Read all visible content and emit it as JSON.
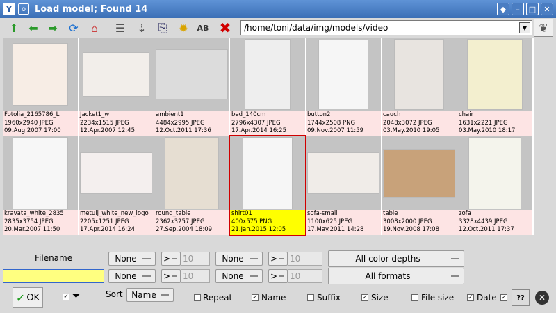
{
  "window": {
    "title": "Load model; Found 14"
  },
  "path": {
    "value": "/home/toni/data/img/models/video"
  },
  "items": [
    {
      "name": "Fotolia_2165786_L",
      "dims": "1960x2940 JPEG",
      "date": "09.Aug.2007 17:00"
    },
    {
      "name": "Jacket1_w",
      "dims": "2234x1515 JPEG",
      "date": "12.Apr.2007 12:45"
    },
    {
      "name": "ambient1",
      "dims": "4484x2995 JPEG",
      "date": "12.Oct.2011 17:36"
    },
    {
      "name": "bed_140cm",
      "dims": "2796x4307 JPEG",
      "date": "17.Apr.2014 16:25"
    },
    {
      "name": "button2",
      "dims": "1744x2508 PNG",
      "date": "09.Nov.2007 11:59"
    },
    {
      "name": "cauch",
      "dims": "2048x3072 JPEG",
      "date": "03.May.2010 19:05"
    },
    {
      "name": "chair",
      "dims": "1631x2221 JPEG",
      "date": "03.May.2010 18:17"
    },
    {
      "name": "kravata_white_2835",
      "dims": "2835x3754 JPEG",
      "date": "20.Mar.2007 11:50"
    },
    {
      "name": "metulj_white_new_logo",
      "dims": "2205x1251 JPEG",
      "date": "17.Apr.2014 16:24"
    },
    {
      "name": "round_table",
      "dims": "2362x3257 JPEG",
      "date": "27.Sep.2004 18:09"
    },
    {
      "name": "shirt01",
      "dims": "400x575 PNG",
      "date": "21.Jan.2015 12:05"
    },
    {
      "name": "sofa-small",
      "dims": "1100x625 JPEG",
      "date": "17.May.2011 14:28"
    },
    {
      "name": "table",
      "dims": "3008x2000 JPEG",
      "date": "19.Nov.2008 17:08"
    },
    {
      "name": "zofa",
      "dims": "3328x4439 JPEG",
      "date": "12.Oct.2011 17:37"
    }
  ],
  "filters": {
    "filename_label": "Filename",
    "none": "None",
    "gt": ">",
    "num": "10",
    "color_depths": "All color depths",
    "formats": "All formats"
  },
  "footer": {
    "ok": "OK",
    "sort_label": "Sort",
    "sort_value": "Name",
    "repeat": "Repeat",
    "name": "Name",
    "suffix": "Suffix",
    "size": "Size",
    "filesize": "File size",
    "date": "Date",
    "help": "??"
  }
}
